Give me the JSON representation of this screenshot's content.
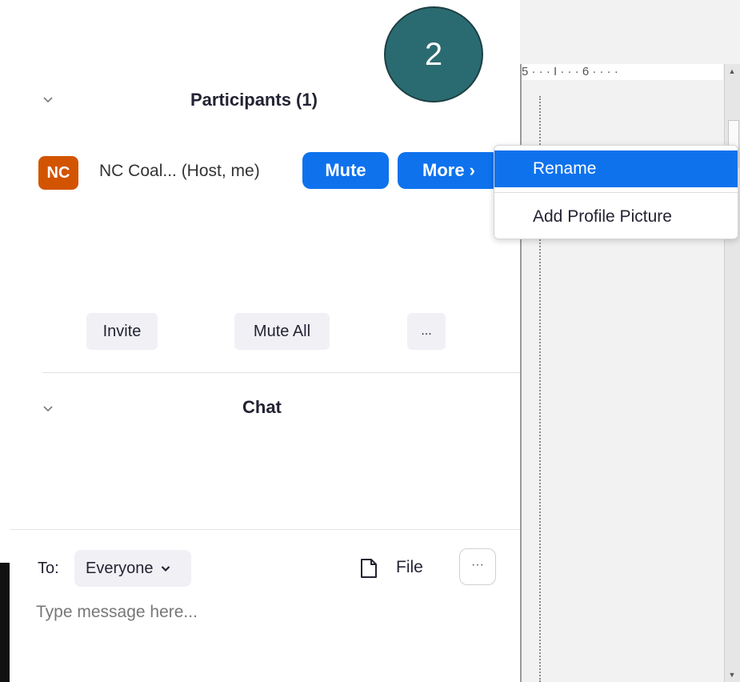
{
  "step_badge": "2",
  "ruler_text": "5 · · · I · · · 6 · · · ·",
  "participants": {
    "title": "Participants (1)",
    "list": [
      {
        "initials": "NC",
        "name": "NC Coal... (Host, me)",
        "mute_label": "Mute",
        "more_label": "More ›"
      }
    ],
    "actions": {
      "invite": "Invite",
      "mute_all": "Mute All",
      "more": "..."
    }
  },
  "context_menu": {
    "items": [
      "Rename",
      "Add Profile Picture"
    ],
    "highlighted": "Rename"
  },
  "chat": {
    "title": "Chat",
    "to_label": "To:",
    "recipient": "Everyone",
    "file_label": "File",
    "more": "···",
    "input_placeholder": "Type message here..."
  },
  "colors": {
    "accent": "#0e72ed",
    "avatar": "#d35400",
    "badge": "#2a6b71"
  },
  "icons": {
    "collapse": "chevron-down-icon",
    "recipient_dropdown": "chevron-down-icon",
    "file": "file-icon",
    "more": "ellipsis-icon"
  }
}
